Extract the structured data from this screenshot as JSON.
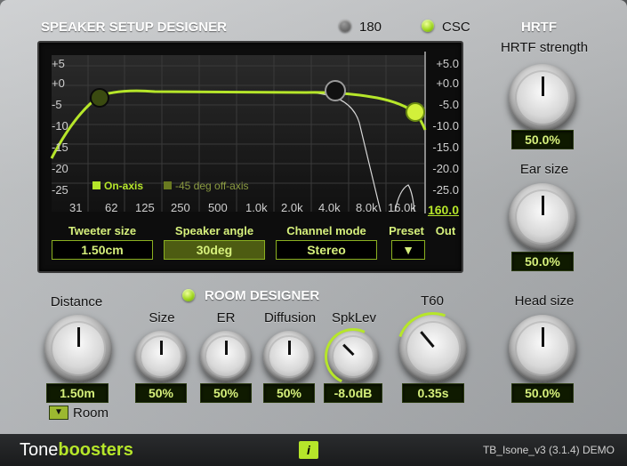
{
  "header": {
    "title": "SPEAKER SETUP DESIGNER"
  },
  "modes": {
    "opt180": "180",
    "csc": "CSC"
  },
  "hrtf": {
    "title": "HRTF",
    "strength_label": "HRTF strength",
    "strength_value": "50.0%",
    "ear_label": "Ear size",
    "ear_value": "50.0%",
    "head_label": "Head size",
    "head_value": "50.0%"
  },
  "graph": {
    "y_left": [
      "+5",
      "+0",
      "-5",
      "-10",
      "-15",
      "-20",
      "-25"
    ],
    "y_right": [
      "+5.0",
      "+0.0",
      "-5.0",
      "-10.0",
      "-15.0",
      "-20.0",
      "-25.0",
      "160.0"
    ],
    "x_labels": [
      "31",
      "62",
      "125",
      "250",
      "500",
      "1.0k",
      "2.0k",
      "4.0k",
      "8.0k",
      "16.0k"
    ],
    "legend_on": "On-axis",
    "legend_off": "-45 deg off-axis"
  },
  "controls": {
    "tweeter_label": "Tweeter size",
    "tweeter_value": "1.50cm",
    "angle_label": "Speaker angle",
    "angle_value": "30deg",
    "mode_label": "Channel mode",
    "mode_value": "Stereo",
    "preset_label": "Preset",
    "preset_arrow": "▼",
    "out_label": "Out"
  },
  "room": {
    "title": "ROOM DESIGNER",
    "distance_label": "Distance",
    "distance_value": "1.50m",
    "size_label": "Size",
    "size_value": "50%",
    "er_label": "ER",
    "er_value": "50%",
    "diffusion_label": "Diffusion",
    "diffusion_value": "50%",
    "spklev_label": "SpkLev",
    "spklev_value": "-8.0dB",
    "t60_label": "T60",
    "t60_value": "0.35s",
    "room_toggle_label": "Room",
    "room_arrow": "▼"
  },
  "footer": {
    "brand_a": "Tone",
    "brand_b": "boosters",
    "info_icon": "i",
    "version": "TB_Isone_v3 (3.1.4) DEMO"
  },
  "colors": {
    "accent": "#b6e62a",
    "lcd_text": "#d6f07c"
  }
}
